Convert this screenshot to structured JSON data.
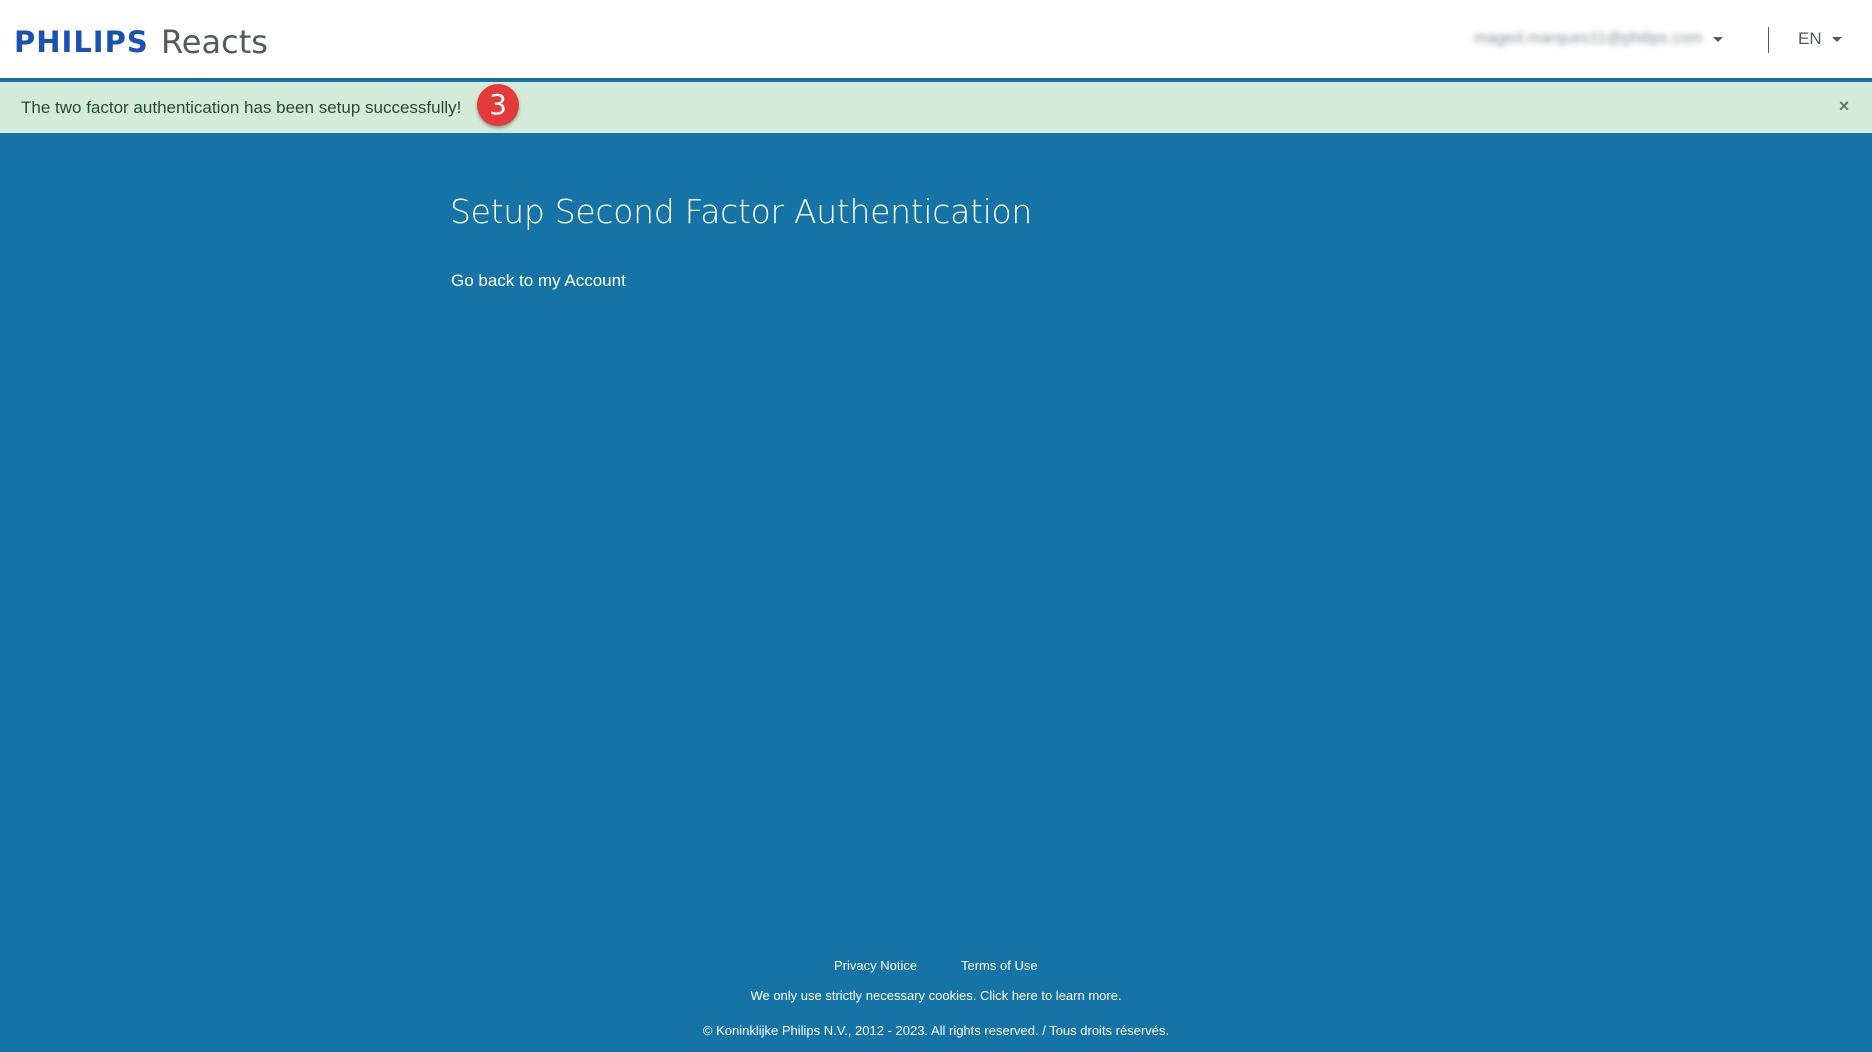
{
  "header": {
    "brand": "PHILIPS",
    "app_name": "Reacts",
    "user_email": "maged.marques11@philips.com",
    "language": "EN"
  },
  "alert": {
    "message": "The two factor authentication has been setup successfully!",
    "close_symbol": "×",
    "step_badge": "3"
  },
  "main": {
    "title": "Setup Second Factor Authentication",
    "back_link": "Go back to my Account"
  },
  "footer": {
    "privacy": "Privacy Notice",
    "terms": "Terms of Use",
    "cookies": "We only use strictly necessary cookies. Click here to learn more.",
    "copyright": "© Koninklijke Philips N.V., 2012 - 2023. All rights reserved. / Tous droits réservés."
  },
  "colors": {
    "page_background": "#1574a5",
    "brand_blue": "#1a51b5",
    "alert_background": "#d4ebd9",
    "alert_text": "#214d2d",
    "badge_red": "#e53a3a"
  },
  "icons": {
    "user_menu_caret": "chevron-down-icon",
    "language_caret": "chevron-down-icon",
    "alert_close": "close-icon"
  }
}
